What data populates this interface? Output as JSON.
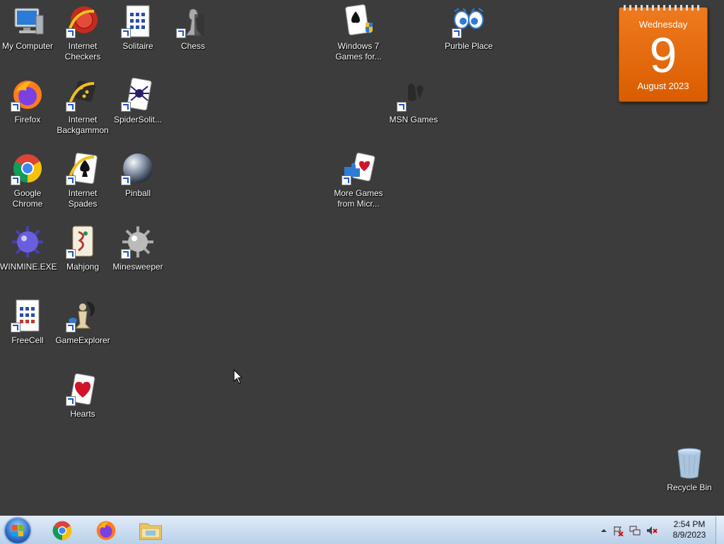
{
  "desktop": {
    "icons": [
      {
        "label": "My Computer"
      },
      {
        "label": "Internet\nCheckers"
      },
      {
        "label": "Solitaire"
      },
      {
        "label": "Chess"
      },
      {
        "label": "Windows 7\nGames for..."
      },
      {
        "label": "Purble Place"
      },
      {
        "label": "Firefox"
      },
      {
        "label": "Internet\nBackgammon"
      },
      {
        "label": "SpiderSolit..."
      },
      {
        "label": "MSN Games"
      },
      {
        "label": "Google\nChrome"
      },
      {
        "label": "Internet\nSpades"
      },
      {
        "label": "Pinball"
      },
      {
        "label": "More Games\nfrom Micr..."
      },
      {
        "label": "WINMINE.EXE"
      },
      {
        "label": "Mahjong"
      },
      {
        "label": "Minesweeper"
      },
      {
        "label": "FreeCell"
      },
      {
        "label": "GameExplorer"
      },
      {
        "label": "Hearts"
      },
      {
        "label": "Recycle Bin"
      }
    ]
  },
  "calendar_gadget": {
    "weekday": "Wednesday",
    "day": "9",
    "month_year": "August 2023"
  },
  "taskbar": {
    "pinned": [
      "chrome-icon",
      "firefox-icon",
      "file-explorer-icon"
    ],
    "clock": {
      "time": "2:54 PM",
      "date": "8/9/2023"
    }
  },
  "colors": {
    "desktop_bg": "#3c3c3c",
    "calendar_orange": "#e86b10",
    "taskbar": "#c8dbef"
  }
}
